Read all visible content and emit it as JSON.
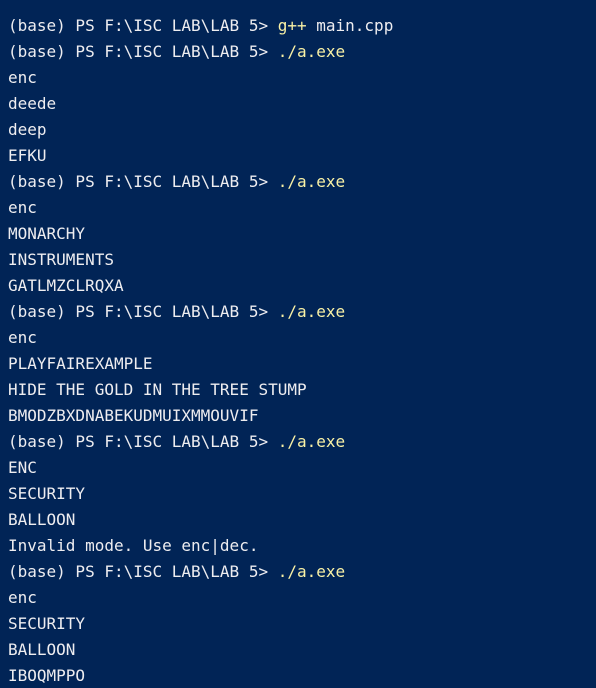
{
  "terminal": {
    "colors": {
      "background": "#012456",
      "foreground": "#eeedf0",
      "command": "#f9f1a5"
    },
    "lines": [
      {
        "type": "prompt",
        "prompt": "(base) PS F:\\ISC LAB\\LAB 5> ",
        "command": "g++",
        "args": " main.cpp"
      },
      {
        "type": "prompt",
        "prompt": "(base) PS F:\\ISC LAB\\LAB 5> ",
        "command": "./a.exe",
        "args": ""
      },
      {
        "type": "output",
        "text": "enc"
      },
      {
        "type": "output",
        "text": "deede"
      },
      {
        "type": "output",
        "text": "deep"
      },
      {
        "type": "output",
        "text": "EFKU"
      },
      {
        "type": "prompt",
        "prompt": "(base) PS F:\\ISC LAB\\LAB 5> ",
        "command": "./a.exe",
        "args": ""
      },
      {
        "type": "output",
        "text": "enc"
      },
      {
        "type": "output",
        "text": "MONARCHY"
      },
      {
        "type": "output",
        "text": "INSTRUMENTS"
      },
      {
        "type": "output",
        "text": "GATLMZCLRQXA"
      },
      {
        "type": "prompt",
        "prompt": "(base) PS F:\\ISC LAB\\LAB 5> ",
        "command": "./a.exe",
        "args": ""
      },
      {
        "type": "output",
        "text": "enc"
      },
      {
        "type": "output",
        "text": "PLAYFAIREXAMPLE"
      },
      {
        "type": "output",
        "text": "HIDE THE GOLD IN THE TREE STUMP"
      },
      {
        "type": "output",
        "text": "BMODZBXDNABEKUDMUIXMMOUVIF"
      },
      {
        "type": "prompt",
        "prompt": "(base) PS F:\\ISC LAB\\LAB 5> ",
        "command": "./a.exe",
        "args": ""
      },
      {
        "type": "output",
        "text": "ENC"
      },
      {
        "type": "output",
        "text": "SECURITY"
      },
      {
        "type": "output",
        "text": "BALLOON"
      },
      {
        "type": "output",
        "text": "Invalid mode. Use enc|dec."
      },
      {
        "type": "prompt",
        "prompt": "(base) PS F:\\ISC LAB\\LAB 5> ",
        "command": "./a.exe",
        "args": ""
      },
      {
        "type": "output",
        "text": "enc"
      },
      {
        "type": "output",
        "text": "SECURITY"
      },
      {
        "type": "output",
        "text": "BALLOON"
      },
      {
        "type": "output",
        "text": "IBOQMPPO"
      }
    ]
  }
}
